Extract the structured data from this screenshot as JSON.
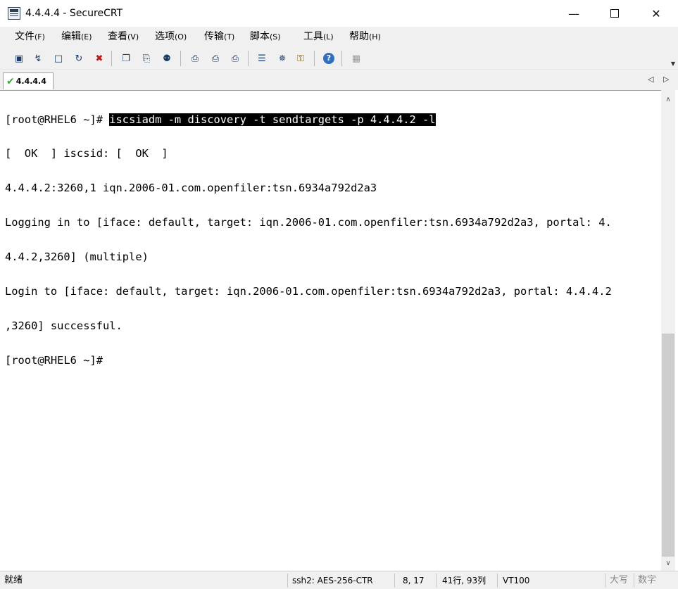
{
  "window": {
    "title": "4.4.4.4 - SecureCRT"
  },
  "menu": [
    {
      "label": "文件",
      "accel": "(F)"
    },
    {
      "label": "编辑",
      "accel": "(E)"
    },
    {
      "label": "查看",
      "accel": "(V)"
    },
    {
      "label": "选项",
      "accel": "(O)"
    },
    {
      "label": "传输",
      "accel": "(T)"
    },
    {
      "label": "脚本",
      "accel": "(S)"
    },
    {
      "label": "工具",
      "accel": "(L)"
    },
    {
      "label": "帮助",
      "accel": "(H)"
    }
  ],
  "tab": {
    "label": "4.4.4.4"
  },
  "terminal": {
    "prompt1": "[root@RHEL6 ~]# ",
    "command": "iscsiadm -m discovery -t sendtargets -p 4.4.4.2 -l",
    "lines": [
      "[  OK  ] iscsid: [  OK  ]",
      "4.4.4.2:3260,1 iqn.2006-01.com.openfiler:tsn.6934a792d2a3",
      "Logging in to [iface: default, target: iqn.2006-01.com.openfiler:tsn.6934a792d2a3, portal: 4.",
      "4.4.2,3260] (multiple)",
      "Login to [iface: default, target: iqn.2006-01.com.openfiler:tsn.6934a792d2a3, portal: 4.4.4.2",
      ",3260] successful.",
      "[root@RHEL6 ~]#"
    ]
  },
  "status": {
    "ready": "就绪",
    "cipher": "ssh2: AES-256-CTR",
    "cursor": "8,  17",
    "size": "41行, 93列",
    "emulation": "VT100",
    "caps": "大写",
    "num": "数字"
  }
}
